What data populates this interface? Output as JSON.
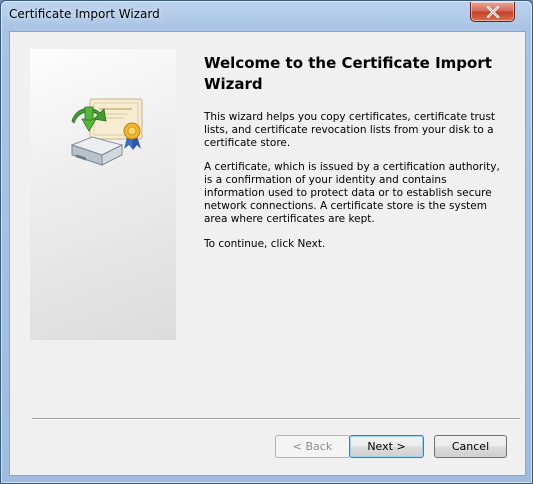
{
  "window": {
    "title": "Certificate Import Wizard"
  },
  "content": {
    "heading": "Welcome to the Certificate Import Wizard",
    "paragraph1": "This wizard helps you copy certificates, certificate trust lists, and certificate revocation lists from your disk to a certificate store.",
    "paragraph2": "A certificate, which is issued by a certification authority, is a confirmation of your identity and contains information used to protect data or to establish secure network connections. A certificate store is the system area where certificates are kept.",
    "paragraph3": "To continue, click Next."
  },
  "buttons": {
    "back": "< Back",
    "next": "Next >",
    "cancel": "Cancel"
  },
  "icons": {
    "close": "close-icon",
    "banner": "certificate-import-icon"
  },
  "colors": {
    "titlebar": "#a9c3e4",
    "close_button": "#c2412a",
    "client_background": "#f0f0f0",
    "default_button_border": "#3c7fb1"
  }
}
